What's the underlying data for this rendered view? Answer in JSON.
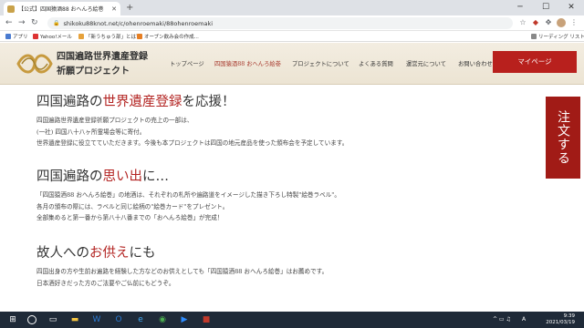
{
  "browser": {
    "tab_title": "【公式】四国猿酒88 おへんろ絵巻",
    "url": "shikoku88knot.net/c/ohenroemaki/88ohenroemaki",
    "bookmarks": [
      "アプリ",
      "Yahoo!メール",
      "「新うちゅう部」とは？",
      "オーブン飲み会の作成...",
      "リーディング リスト"
    ]
  },
  "site": {
    "title_line1": "四国遍路世界遺産登録",
    "title_line2": "祈願プロジェクト",
    "nav": [
      "トップページ",
      "四国猿酒88 おへんろ絵巻",
      "プロジェクトについて",
      "よくある質問",
      "運営元について",
      "お問い合わせ"
    ],
    "mypage_label": "マイページ",
    "order_label": "注文する"
  },
  "content": {
    "s1_pre": "四国遍路の",
    "s1_red": "世界遺産登録",
    "s1_post": "を応援！",
    "s1_lines": [
      "四国遍路世界遺産登録祈願プロジェクトの売上の一部は、",
      "(一社) 四国八十八ヶ所霊場会等に寄付。",
      "世界遺産登録に役立てていただきます。今後も本プロジェクトは四国の地元産品を使った頒布会を予定しています。"
    ],
    "s2_pre": "四国遍路の",
    "s2_red": "思い出",
    "s2_post": "に…",
    "s2_lines": [
      "「四国猿酒88 おへんろ絵巻」の地酒は、それぞれの札所や遍路道をイメージした描き下ろし特製\"絵巻ラベル\"。",
      "各月の頒布の際には、ラベルと同じ絵柄の\"絵巻カード\"をプレゼント。",
      "全部集めると第一番から第八十八番までの「おへんろ絵巻」が完成！"
    ],
    "s3_pre": "故人への",
    "s3_red": "お供え",
    "s3_post": "にも",
    "s3_lines": [
      "四国出身の方や生前お遍路を経験した方などのお供えとしても「四国猿酒88 おへんろ絵巻」はお薦めです。",
      "日本酒好きだった方のご法要やご仏前にもどうぞ。"
    ]
  },
  "taskbar": {
    "time": "9:39",
    "date": "2021/03/19"
  },
  "colors": {
    "accent_red": "#b32422",
    "header_beige": "#efe8d8",
    "taskbar": "#1f2a38"
  }
}
